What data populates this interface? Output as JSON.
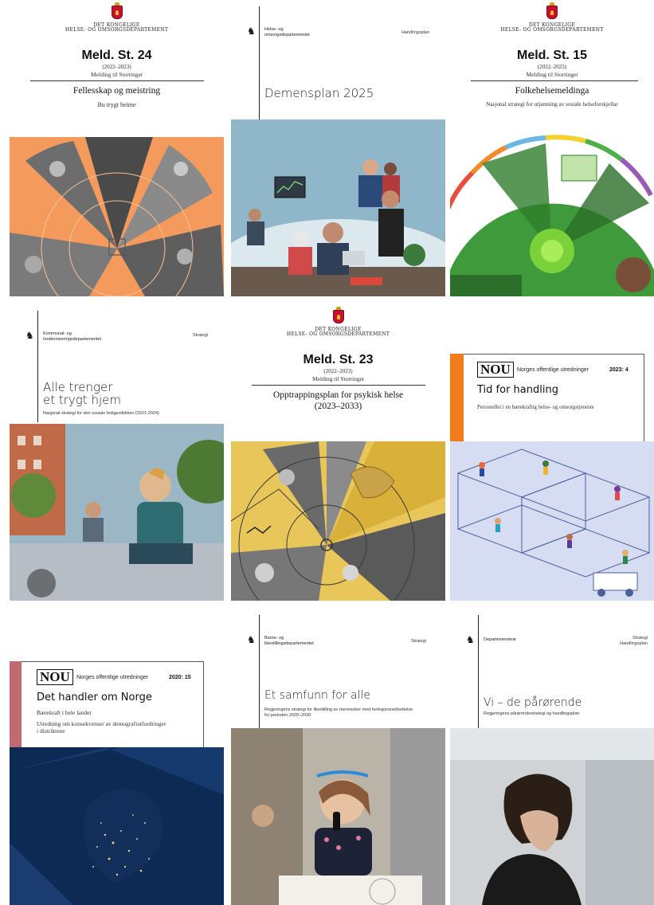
{
  "covers": [
    {
      "royal_line1": "DET KONGELIGE",
      "royal_line2": "HELSE- OG OMSORGSDEPARTEMENT",
      "meld": "Meld. St. 24",
      "year": "(2022–2023)",
      "meld_til": "Melding til Stortinget",
      "title": "Fellesskap og meistring",
      "subtitle": "Bu trygt heime"
    },
    {
      "dept_line1": "Helse- og",
      "dept_line2": "omsorgsdepartementet",
      "kind": "Handlingsplan",
      "title": "Demensplan 2025"
    },
    {
      "royal_line1": "DET KONGELIGE",
      "royal_line2": "HELSE- OG OMSORGSDEPARTEMENT",
      "meld": "Meld. St. 15",
      "year": "(2022–2023)",
      "meld_til": "Melding til Stortinget",
      "title": "Folkehelsemeldinga",
      "subtitle": "Nasjonal strategi for utjamning av sosiale helseforskjellar"
    },
    {
      "dept_line1": "Kommunal- og",
      "dept_line2": "moderniseringsdepartementet",
      "kind": "Strategi",
      "title_line1": "Alle trenger",
      "title_line2": "et trygt hjem",
      "subtitle": "Nasjonal strategi for den sosiale boligpolitikken (2021-2024)"
    },
    {
      "royal_line1": "DET KONGELIGE",
      "royal_line2": "HELSE- OG OMSORGSDEPARTEMENT",
      "meld": "Meld. St. 23",
      "year": "(2022–2023)",
      "meld_til": "Melding til Stortinget",
      "title_line1": "Opptrappingsplan for psykisk helse",
      "title_line2": "(2023–2033)"
    },
    {
      "nou": "NOU",
      "nou_label": "Norges offentlige utredninger",
      "nou_num": "2023: 4",
      "title": "Tid for handling",
      "subtitle": "Personellet i en bærekraftig helse- og omsorgstjeneste"
    },
    {
      "nou": "NOU",
      "nou_label": "Norges offentlige utredninger",
      "nou_num": "2020: 15",
      "title": "Det handler om Norge",
      "subtitle1": "Bærekraft i hele landet",
      "subtitle2_line1": "Utredning om konsekvenser av demografiutfordringer",
      "subtitle2_line2": "i distriktene"
    },
    {
      "dept_line1": "Barne- og",
      "dept_line2": "likestillingsdepartementet",
      "kind": "Strategi",
      "title": "Et samfunn for alle",
      "subtitle_line1": "Regjeringens strategi for likestilling av mennesker med funksjonsnedsettelse",
      "subtitle_line2": "for perioden 2020–2030"
    },
    {
      "dept_line1": "Departementene",
      "kind_line1": "Strategi",
      "kind_line2": "Handlingsplan",
      "title": "Vi – de pårørende",
      "subtitle": "Regjeringens pårørendestrategi og handlingsplan"
    }
  ],
  "colors": {
    "orange": "#f39a5c",
    "blue_bg": "#8fb7c9",
    "green": "#3f9a3c",
    "yellow": "#e8c65a",
    "nou_orange": "#f07d1a",
    "nou_rose": "#c06a72",
    "lavender": "#d6dcf2",
    "night_blue": "#0d2a55"
  },
  "icons": [
    "coat-of-arms-icon",
    "norwegian-lion-icon"
  ]
}
